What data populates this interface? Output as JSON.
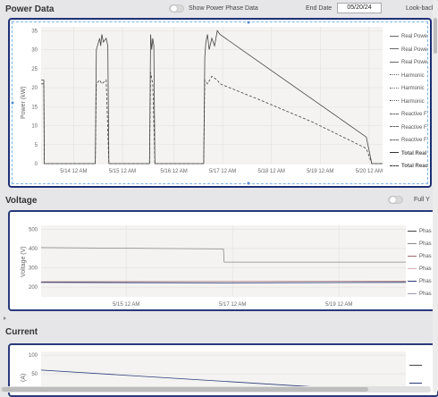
{
  "power": {
    "title": "Power Data",
    "toggle_label": "Show Power Phase Data",
    "end_date_label": "End Date",
    "end_date_value": "05/20/24",
    "lookback_label": "Look-back",
    "y_axis_label": "Power (kW)",
    "legend": [
      {
        "label": "Real Powe",
        "style": "solid"
      },
      {
        "label": "Real Powe",
        "style": "solid"
      },
      {
        "label": "Real Powe",
        "style": "solid"
      },
      {
        "label": "Harmonic",
        "style": "dotted"
      },
      {
        "label": "Harmonic",
        "style": "dotted"
      },
      {
        "label": "Harmonic",
        "style": "dotted"
      },
      {
        "label": "Reactive F",
        "style": "dashed"
      },
      {
        "label": "Reactive F",
        "style": "dashed"
      },
      {
        "label": "Reactive F",
        "style": "dashed"
      },
      {
        "label": "Total Real",
        "style": "solid-bold"
      },
      {
        "label": "Total Reac",
        "style": "dashed-bold"
      }
    ]
  },
  "voltage": {
    "title": "Voltage",
    "toggle_label": "Full Y",
    "y_axis_label": "Voltage (V)",
    "legend": [
      "Phas",
      "Phas",
      "Phas",
      "Phas",
      "Phas",
      "Phas"
    ]
  },
  "current": {
    "title": "Current",
    "y_axis_label": "(A)"
  },
  "chart_data": [
    {
      "type": "line",
      "title": "Power Data",
      "ylabel": "Power (kW)",
      "xlabel": "",
      "ylim": [
        0,
        36
      ],
      "yticks": [
        0,
        5,
        10,
        15,
        20,
        25,
        30,
        35
      ],
      "xticks": [
        "5/14 12 AM",
        "5/15 12 AM",
        "5/16 12 AM",
        "5/17 12 AM",
        "5/18 12 AM",
        "5/19 12 AM",
        "5/20 12 AM"
      ],
      "grid": true,
      "legend_position": "right",
      "series": [
        {
          "name": "Total Real",
          "style": "solid",
          "x": [
            0.0,
            0.05,
            0.06,
            0.07,
            0.08,
            0.5,
            1.0,
            1.02,
            1.08,
            1.1,
            1.12,
            1.15,
            1.2,
            1.23,
            1.25,
            1.5,
            2.0,
            2.02,
            2.04,
            2.06,
            2.08,
            2.1,
            2.12,
            2.5,
            3.0,
            3.02,
            3.04,
            3.07,
            3.1,
            3.15,
            3.2,
            3.25,
            3.3,
            4.0,
            5.0,
            6.0,
            6.1,
            6.3
          ],
          "y": [
            22,
            22,
            0,
            0,
            0,
            0,
            0,
            30,
            33,
            31,
            34,
            32,
            33,
            31,
            0,
            0,
            0,
            34,
            30,
            33,
            31,
            0,
            0,
            0,
            0,
            28,
            32,
            34,
            30,
            33,
            31,
            35,
            34,
            27,
            17,
            7,
            0,
            0
          ]
        },
        {
          "name": "Total Reac",
          "style": "dashed",
          "x": [
            0.0,
            0.05,
            0.06,
            0.5,
            1.0,
            1.02,
            1.08,
            1.12,
            1.2,
            1.25,
            1.5,
            2.0,
            2.02,
            2.06,
            2.1,
            2.12,
            2.5,
            3.0,
            3.02,
            3.07,
            3.15,
            3.25,
            3.3,
            4.0,
            5.0,
            6.0,
            6.1,
            6.3
          ],
          "y": [
            21,
            21,
            0,
            0,
            0,
            21,
            22,
            21,
            22,
            0,
            0,
            0,
            24,
            21,
            0,
            0,
            0,
            0,
            22,
            21,
            23,
            22,
            21,
            17,
            11,
            4,
            0,
            0
          ]
        }
      ]
    },
    {
      "type": "line",
      "title": "Voltage",
      "ylabel": "Voltage (V)",
      "ylim": [
        150,
        520
      ],
      "yticks": [
        200,
        300,
        400,
        500
      ],
      "xticks": [
        "5/15 12 AM",
        "5/17 12 AM",
        "5/19 12 AM"
      ],
      "grid": true,
      "legend_position": "right",
      "series": [
        {
          "name": "Phas",
          "color": "#888888",
          "x": [
            0,
            3,
            3.01,
            6
          ],
          "y": [
            405,
            398,
            330,
            330
          ]
        },
        {
          "name": "Phas",
          "color": "#2a3a7a",
          "x": [
            0,
            3,
            3.01,
            6
          ],
          "y": [
            225,
            222,
            222,
            225
          ]
        },
        {
          "name": "Phas",
          "color": "#9a6a6a",
          "x": [
            0,
            6
          ],
          "y": [
            228,
            230
          ]
        }
      ]
    },
    {
      "type": "line",
      "title": "Current",
      "ylabel": "(A)",
      "yticks": [
        50,
        100
      ],
      "ylim": [
        0,
        110
      ],
      "series": [
        {
          "name": "",
          "color": "#2a3a7a",
          "x": [
            0,
            6
          ],
          "y": [
            60,
            0
          ]
        }
      ]
    }
  ]
}
